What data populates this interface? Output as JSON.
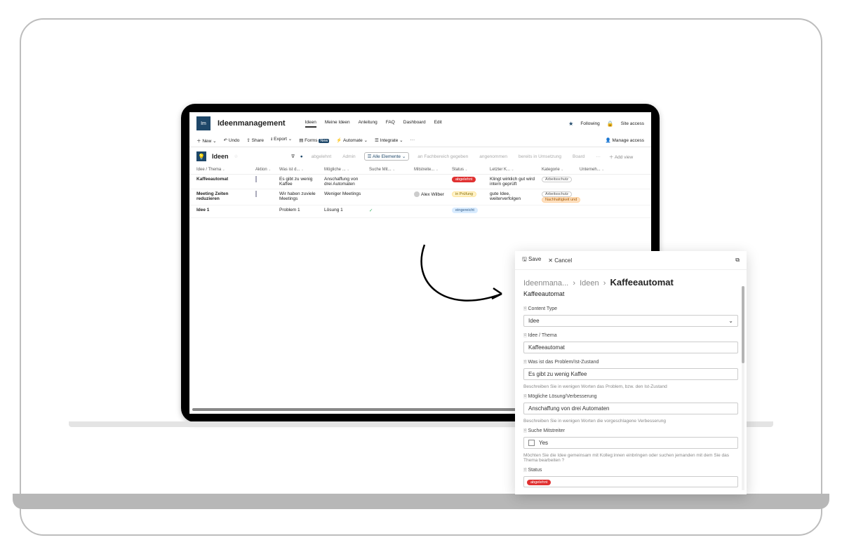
{
  "site": {
    "logo": "Im",
    "title": "Ideenmanagement",
    "nav": [
      "Ideen",
      "Meine Ideen",
      "Anleitung",
      "FAQ",
      "Dashboard",
      "Edit"
    ],
    "active_nav": 0,
    "following": "Following",
    "site_access": "Site access"
  },
  "toolbar": {
    "new": "New",
    "undo": "Undo",
    "share": "Share",
    "export": "Export",
    "forms": "Forms",
    "forms_pill": "New",
    "automate": "Automate",
    "integrate": "Integrate",
    "manage_access": "Manage access"
  },
  "list": {
    "name": "Ideen",
    "views": [
      "abgelehnt",
      "Admin",
      "Alle Elemente",
      "an Fachbereich gegeben",
      "angenommen",
      "bereits in Umsetzung",
      "Board"
    ],
    "active_view": 2,
    "add_view": "Add view"
  },
  "columns": [
    "Idee / Thema",
    "Aktion",
    "Was ist d...",
    "Mögliche ...",
    "Suche Mit...",
    "Mitstreite...",
    "Status",
    "Letzter K...",
    "Kategorie",
    "Unterneh..."
  ],
  "rows": [
    {
      "idea": "Kaffeeautomat",
      "action_icon": true,
      "problem": "Es gibt zu wenig Kaffee",
      "solution": "Anschaffung von drei Automaten",
      "suche": "",
      "mitstreiter": "",
      "status": {
        "text": "abgelehnt",
        "class": "b-red"
      },
      "comment": "Klingt wirklich gut wird intern geprüft",
      "kategorie": [
        {
          "text": "Arbeitsschutz",
          "class": "b-outline"
        }
      ],
      "unternehmen": ""
    },
    {
      "idea": "Meeting Zeiten reduzieren",
      "action_icon": true,
      "problem": "Wir haben zuviele Meetings",
      "solution": "Weniger Meetings",
      "suche": "",
      "mitstreiter": "Alex Wilber",
      "status": {
        "text": "in Prüfung",
        "class": "b-yellow"
      },
      "comment": "gute Idee, weiterverfolgen",
      "kategorie": [
        {
          "text": "Arbeitsschutz",
          "class": "b-outline"
        },
        {
          "text": "Nachhaltigkeit und",
          "class": "b-orange"
        }
      ],
      "unternehmen": ""
    },
    {
      "idea": "Idee 1",
      "action_icon": false,
      "problem": "Problem 1",
      "solution": "Lösung 1",
      "suche": "✓",
      "mitstreiter": "",
      "status": {
        "text": "eingereicht",
        "class": "b-blue"
      },
      "comment": "",
      "kategorie": [],
      "unternehmen": ""
    }
  ],
  "panel": {
    "save": "Save",
    "cancel": "Cancel",
    "breadcrumb": [
      "Ideenmana...",
      "Ideen",
      "Kaffeeautomat"
    ],
    "subtitle": "Kaffeeautomat",
    "ct_label": "Content Type",
    "ct_value": "Idee",
    "f1_label": "Idee / Thema",
    "f1_value": "Kaffeeautomat",
    "f2_label": "Was ist das Problem/Ist-Zustand",
    "f2_value": "Es gibt zu wenig Kaffee",
    "f2_help": "Beschreiben Sie in wenigen Worten das Problem, bzw. den Ist-Zustand",
    "f3_label": "Mögliche Lösung/Verbesserung",
    "f3_value": "Anschaffung von drei Automaten",
    "f3_help": "Beschreiben Sie in wenigen Worten die vorgeschlagene Verbesserung",
    "f4_label": "Suche Mitstreiter",
    "f4_value": "Yes",
    "f4_help": "Möchten Sie die Idee gemeinsam mit Kolleg:innen einbringen oder suchen jemanden mit dem Sie das Thema bearbeiten ?",
    "f5_label": "Status",
    "f5_value": "abgelehnt"
  }
}
